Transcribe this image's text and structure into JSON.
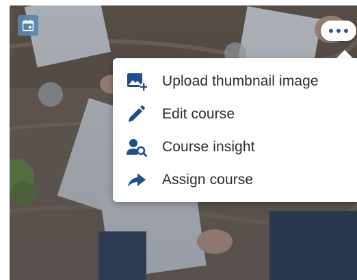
{
  "card": {
    "calendar_icon": "calendar-icon",
    "more_icon": "more-horizontal-icon"
  },
  "menu": {
    "items": [
      {
        "label": "Upload thumbnail image",
        "icon": "image-add-icon"
      },
      {
        "label": "Edit course",
        "icon": "pencil-icon"
      },
      {
        "label": "Course insight",
        "icon": "user-search-icon"
      },
      {
        "label": "Assign course",
        "icon": "share-arrow-icon"
      }
    ]
  },
  "colors": {
    "icon_blue": "#1f4e8c",
    "menu_text": "#2b2b2b",
    "badge": "#5d84ad"
  }
}
